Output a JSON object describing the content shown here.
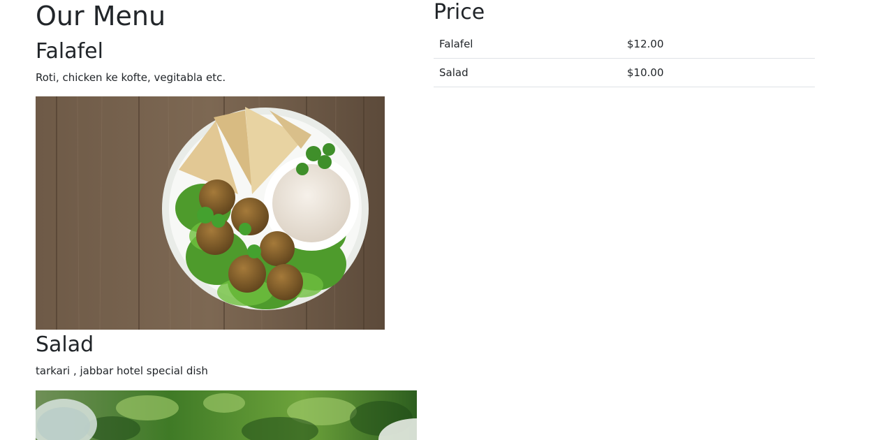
{
  "menu": {
    "title": "Our Menu",
    "items": [
      {
        "name": "Falafel",
        "description": "Roti, chicken ke kofte, vegitabla etc.",
        "image": "falafel-plate-photo"
      },
      {
        "name": "Salad",
        "description": "tarkari , jabbar hotel special dish",
        "image": "salad-greens-photo"
      }
    ]
  },
  "price": {
    "title": "Price",
    "rows": [
      {
        "name": "Falafel",
        "price": "$12.00"
      },
      {
        "name": "Salad",
        "price": "$10.00"
      }
    ]
  },
  "colors": {
    "text": "#212529",
    "divider": "#dee2e6",
    "background": "#ffffff"
  }
}
